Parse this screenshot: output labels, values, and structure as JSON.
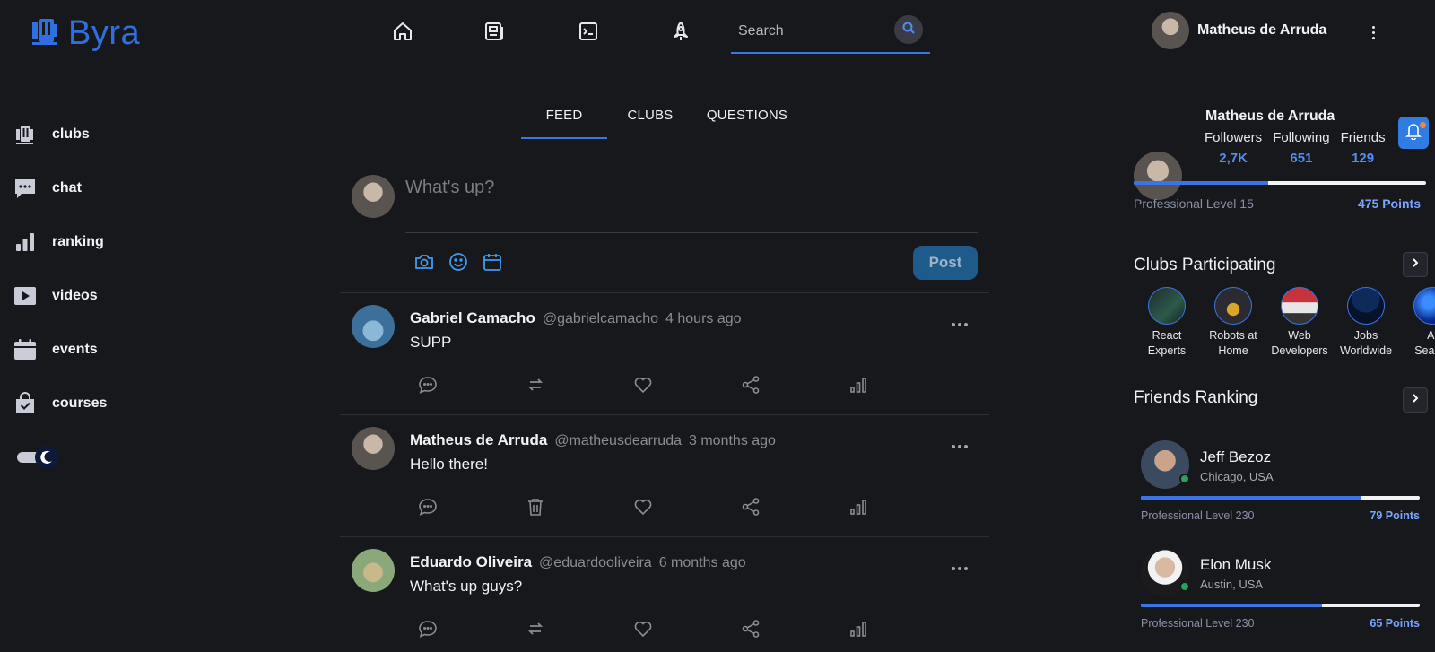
{
  "app": {
    "name": "Byra"
  },
  "topbar": {
    "nav": [
      "home-icon",
      "newspaper-icon",
      "terminal-icon",
      "rocket-icon"
    ],
    "search_placeholder": "Search",
    "user_name": "Matheus de Arruda"
  },
  "sidebar": {
    "items": [
      {
        "label": "clubs",
        "icon": "clubs-icon"
      },
      {
        "label": "chat",
        "icon": "chat-icon"
      },
      {
        "label": "ranking",
        "icon": "ranking-icon"
      },
      {
        "label": "videos",
        "icon": "video-icon"
      },
      {
        "label": "events",
        "icon": "calendar-icon"
      },
      {
        "label": "courses",
        "icon": "bag-icon"
      }
    ],
    "theme_toggle": "dark"
  },
  "tabs": [
    {
      "label": "FEED",
      "active": true
    },
    {
      "label": "CLUBS",
      "active": false
    },
    {
      "label": "QUESTIONS",
      "active": false
    }
  ],
  "composer": {
    "placeholder": "What's up?",
    "post_label": "Post",
    "tools": [
      "camera-icon",
      "emoji-icon",
      "calendar-icon"
    ]
  },
  "posts": [
    {
      "name": "Gabriel Camacho",
      "handle": "@gabrielcamacho",
      "time": "4 hours ago",
      "text": "SUPP",
      "second_action": "repost-icon"
    },
    {
      "name": "Matheus de Arruda",
      "handle": "@matheusdearruda",
      "time": "3 months ago",
      "text": "Hello there!",
      "second_action": "trash-icon"
    },
    {
      "name": "Eduardo Oliveira",
      "handle": "@eduardooliveira",
      "time": "6 months ago",
      "text": "What's up guys?",
      "second_action": "repost-icon"
    }
  ],
  "profile": {
    "name": "Matheus de Arruda",
    "stats": [
      {
        "label": "Followers",
        "value": "2,7K"
      },
      {
        "label": "Following",
        "value": "651"
      },
      {
        "label": "Friends",
        "value": "129"
      }
    ],
    "level": "Professional Level 15",
    "points": "475 Points",
    "progress": 0.46
  },
  "clubs_section": {
    "title": "Clubs Participating",
    "clubs": [
      {
        "name_line1": "React",
        "name_line2": "Experts"
      },
      {
        "name_line1": "Robots at",
        "name_line2": "Home"
      },
      {
        "name_line1": "Web",
        "name_line2": "Developers"
      },
      {
        "name_line1": "Jobs",
        "name_line2": "Worldwide"
      },
      {
        "name_line1": "AI",
        "name_line2": "Search"
      }
    ]
  },
  "friends_section": {
    "title": "Friends Ranking",
    "friends": [
      {
        "name": "Jeff Bezoz",
        "city": "Chicago, USA",
        "level": "Professional Level 230",
        "points": "79 Points",
        "progress": 0.79
      },
      {
        "name": "Elon Musk",
        "city": "Austin, USA",
        "level": "Professional Level 230",
        "points": "65 Points",
        "progress": 0.65
      }
    ]
  },
  "colors": {
    "accent": "#3b74e6",
    "background": "#17181c",
    "brand": "#2f6fe0",
    "online": "#2e9e5b"
  }
}
